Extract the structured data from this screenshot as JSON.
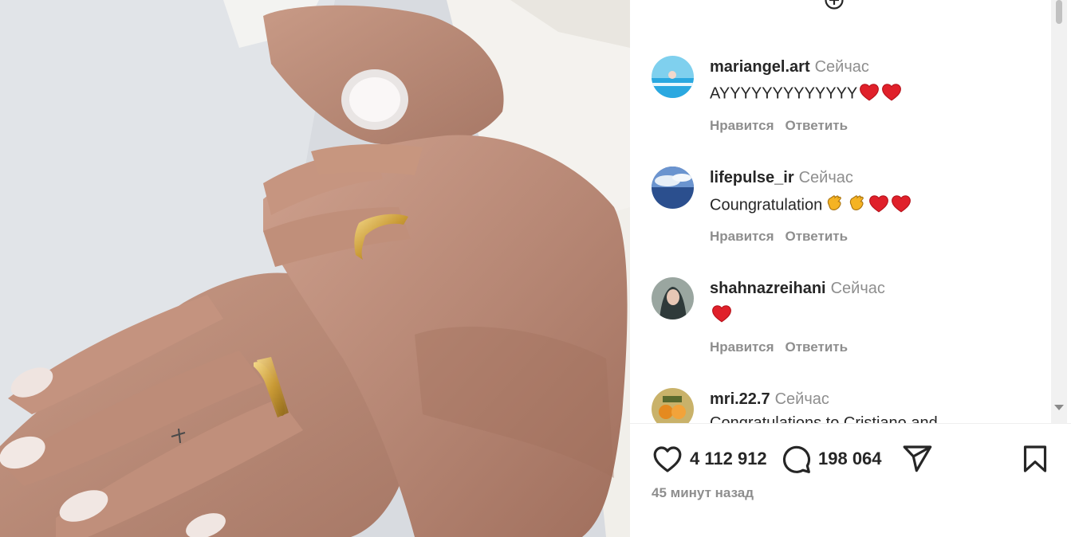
{
  "post": {
    "image_alt": "Photo of two hands with wedding rings on a white tablecloth"
  },
  "comments": [
    {
      "username": "mariangel.art",
      "time": "Сейчас",
      "text": "AYYYYYYYYYYYYY",
      "emojis": [
        "heart",
        "heart"
      ],
      "like_label": "Нравится",
      "reply_label": "Ответить"
    },
    {
      "username": "lifepulse_ir",
      "time": "Сейчас",
      "text": "Coungratulation",
      "emojis": [
        "clap",
        "clap",
        "heart",
        "heart"
      ],
      "like_label": "Нравится",
      "reply_label": "Ответить"
    },
    {
      "username": "shahnazreihani",
      "time": "Сейчас",
      "text": "",
      "emojis": [
        "heart"
      ],
      "like_label": "Нравится",
      "reply_label": "Ответить"
    },
    {
      "username": "mri.22.7",
      "time": "Сейчас",
      "text": "Congratulations to Cristiano and",
      "emojis": [],
      "like_label": "",
      "reply_label": ""
    }
  ],
  "actions": {
    "likes_count": "4 112 912",
    "comments_count": "198 064"
  },
  "timestamp": "45 минут назад",
  "colors": {
    "text": "#262626",
    "secondary": "#8e8e8e",
    "heart": "#e0202a",
    "clap": "#f5b323"
  }
}
